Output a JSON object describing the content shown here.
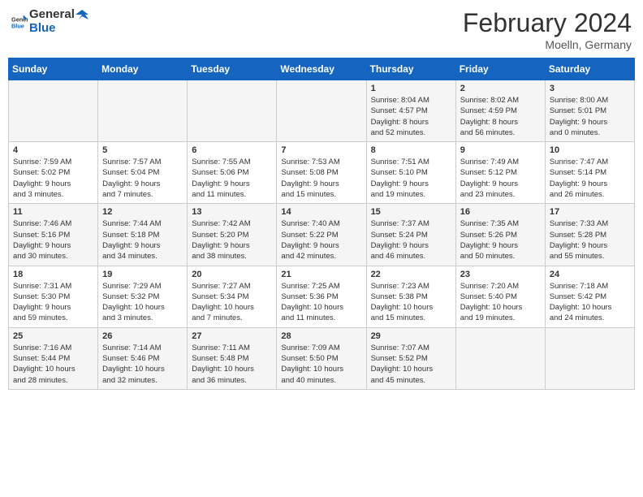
{
  "header": {
    "logo_general": "General",
    "logo_blue": "Blue",
    "month_title": "February 2024",
    "location": "Moelln, Germany"
  },
  "days_of_week": [
    "Sunday",
    "Monday",
    "Tuesday",
    "Wednesday",
    "Thursday",
    "Friday",
    "Saturday"
  ],
  "weeks": [
    [
      {
        "day": "",
        "info": ""
      },
      {
        "day": "",
        "info": ""
      },
      {
        "day": "",
        "info": ""
      },
      {
        "day": "",
        "info": ""
      },
      {
        "day": "1",
        "info": "Sunrise: 8:04 AM\nSunset: 4:57 PM\nDaylight: 8 hours\nand 52 minutes."
      },
      {
        "day": "2",
        "info": "Sunrise: 8:02 AM\nSunset: 4:59 PM\nDaylight: 8 hours\nand 56 minutes."
      },
      {
        "day": "3",
        "info": "Sunrise: 8:00 AM\nSunset: 5:01 PM\nDaylight: 9 hours\nand 0 minutes."
      }
    ],
    [
      {
        "day": "4",
        "info": "Sunrise: 7:59 AM\nSunset: 5:02 PM\nDaylight: 9 hours\nand 3 minutes."
      },
      {
        "day": "5",
        "info": "Sunrise: 7:57 AM\nSunset: 5:04 PM\nDaylight: 9 hours\nand 7 minutes."
      },
      {
        "day": "6",
        "info": "Sunrise: 7:55 AM\nSunset: 5:06 PM\nDaylight: 9 hours\nand 11 minutes."
      },
      {
        "day": "7",
        "info": "Sunrise: 7:53 AM\nSunset: 5:08 PM\nDaylight: 9 hours\nand 15 minutes."
      },
      {
        "day": "8",
        "info": "Sunrise: 7:51 AM\nSunset: 5:10 PM\nDaylight: 9 hours\nand 19 minutes."
      },
      {
        "day": "9",
        "info": "Sunrise: 7:49 AM\nSunset: 5:12 PM\nDaylight: 9 hours\nand 23 minutes."
      },
      {
        "day": "10",
        "info": "Sunrise: 7:47 AM\nSunset: 5:14 PM\nDaylight: 9 hours\nand 26 minutes."
      }
    ],
    [
      {
        "day": "11",
        "info": "Sunrise: 7:46 AM\nSunset: 5:16 PM\nDaylight: 9 hours\nand 30 minutes."
      },
      {
        "day": "12",
        "info": "Sunrise: 7:44 AM\nSunset: 5:18 PM\nDaylight: 9 hours\nand 34 minutes."
      },
      {
        "day": "13",
        "info": "Sunrise: 7:42 AM\nSunset: 5:20 PM\nDaylight: 9 hours\nand 38 minutes."
      },
      {
        "day": "14",
        "info": "Sunrise: 7:40 AM\nSunset: 5:22 PM\nDaylight: 9 hours\nand 42 minutes."
      },
      {
        "day": "15",
        "info": "Sunrise: 7:37 AM\nSunset: 5:24 PM\nDaylight: 9 hours\nand 46 minutes."
      },
      {
        "day": "16",
        "info": "Sunrise: 7:35 AM\nSunset: 5:26 PM\nDaylight: 9 hours\nand 50 minutes."
      },
      {
        "day": "17",
        "info": "Sunrise: 7:33 AM\nSunset: 5:28 PM\nDaylight: 9 hours\nand 55 minutes."
      }
    ],
    [
      {
        "day": "18",
        "info": "Sunrise: 7:31 AM\nSunset: 5:30 PM\nDaylight: 9 hours\nand 59 minutes."
      },
      {
        "day": "19",
        "info": "Sunrise: 7:29 AM\nSunset: 5:32 PM\nDaylight: 10 hours\nand 3 minutes."
      },
      {
        "day": "20",
        "info": "Sunrise: 7:27 AM\nSunset: 5:34 PM\nDaylight: 10 hours\nand 7 minutes."
      },
      {
        "day": "21",
        "info": "Sunrise: 7:25 AM\nSunset: 5:36 PM\nDaylight: 10 hours\nand 11 minutes."
      },
      {
        "day": "22",
        "info": "Sunrise: 7:23 AM\nSunset: 5:38 PM\nDaylight: 10 hours\nand 15 minutes."
      },
      {
        "day": "23",
        "info": "Sunrise: 7:20 AM\nSunset: 5:40 PM\nDaylight: 10 hours\nand 19 minutes."
      },
      {
        "day": "24",
        "info": "Sunrise: 7:18 AM\nSunset: 5:42 PM\nDaylight: 10 hours\nand 24 minutes."
      }
    ],
    [
      {
        "day": "25",
        "info": "Sunrise: 7:16 AM\nSunset: 5:44 PM\nDaylight: 10 hours\nand 28 minutes."
      },
      {
        "day": "26",
        "info": "Sunrise: 7:14 AM\nSunset: 5:46 PM\nDaylight: 10 hours\nand 32 minutes."
      },
      {
        "day": "27",
        "info": "Sunrise: 7:11 AM\nSunset: 5:48 PM\nDaylight: 10 hours\nand 36 minutes."
      },
      {
        "day": "28",
        "info": "Sunrise: 7:09 AM\nSunset: 5:50 PM\nDaylight: 10 hours\nand 40 minutes."
      },
      {
        "day": "29",
        "info": "Sunrise: 7:07 AM\nSunset: 5:52 PM\nDaylight: 10 hours\nand 45 minutes."
      },
      {
        "day": "",
        "info": ""
      },
      {
        "day": "",
        "info": ""
      }
    ]
  ]
}
